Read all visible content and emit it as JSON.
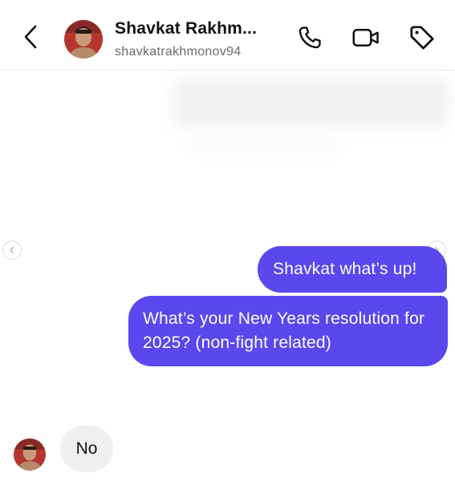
{
  "header": {
    "back_icon": "chevron-left-icon",
    "contact_name": "Shavkat Rakhm...",
    "contact_username": "shavkatrakhmonov94",
    "actions": [
      "phone-icon",
      "video-camera-icon",
      "tag-icon"
    ]
  },
  "messages": [
    {
      "direction": "outgoing",
      "text": "Shavkat what’s up!"
    },
    {
      "direction": "outgoing",
      "text": "What’s your New Years resolution for 2025? (non-fight related)"
    },
    {
      "direction": "incoming",
      "text": "No"
    }
  ],
  "colors": {
    "outgoing_bubble": "#5b47ee",
    "incoming_bubble": "#efefef",
    "secondary_text": "#6b6b6b"
  }
}
